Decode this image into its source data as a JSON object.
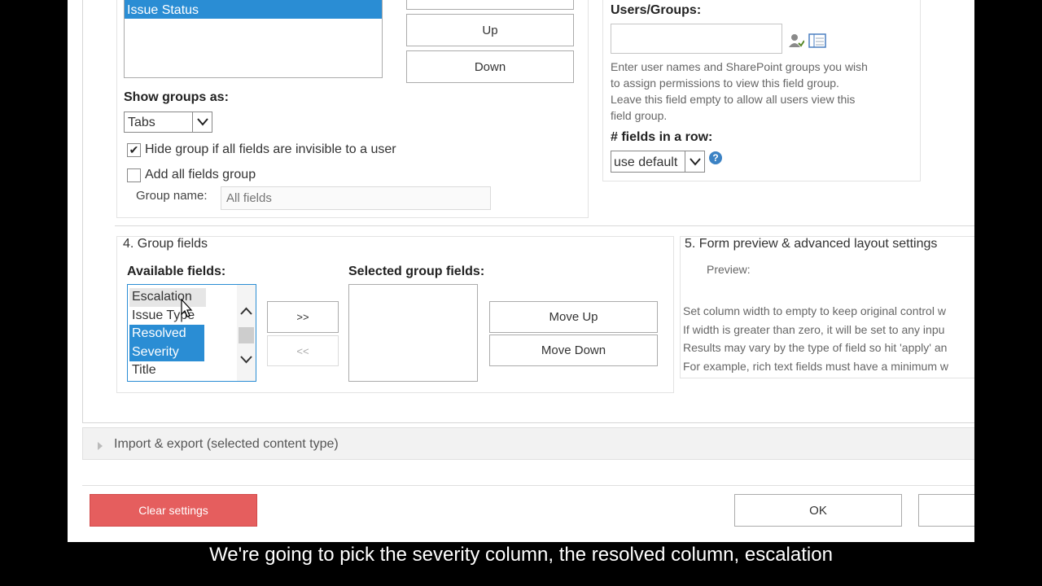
{
  "field_groups": {
    "items": [
      "Issue Status"
    ]
  },
  "order_buttons": {
    "up": "Up",
    "down": "Down"
  },
  "show_groups": {
    "label": "Show groups as:",
    "selected": "Tabs"
  },
  "hide_group": {
    "label": "Hide group if all fields are invisible to a user",
    "checked": true
  },
  "add_all_group": {
    "label": "Add all fields group",
    "checked": false
  },
  "group_name": {
    "label": "Group name:",
    "placeholder": "All fields"
  },
  "users_groups": {
    "label": "Users/Groups:",
    "help": [
      "Enter user names and SharePoint groups you wish",
      "to assign permissions to view this field group.",
      "Leave this field empty to allow all users view this",
      "field group."
    ]
  },
  "fields_in_row": {
    "label": "# fields in a row:",
    "selected": "use default"
  },
  "section4": {
    "title": "4. Group fields",
    "available_label": "Available fields:",
    "available_items": [
      "Escalation",
      "Issue Type",
      "Resolved",
      "Severity",
      "Title"
    ],
    "add_button": ">>",
    "remove_button": "<<",
    "selected_label": "Selected group fields:",
    "move_up": "Move Up",
    "move_down": "Move Down"
  },
  "section5": {
    "title": "5. Form preview & advanced layout settings",
    "preview_label": "Preview:",
    "lines": [
      "Set column width to empty to keep original control w",
      "If width is greater than zero, it will be set to any inpu",
      "Results may vary by the type of field so hit 'apply' an",
      "For example, rich text fields must have a minimum w"
    ]
  },
  "import_export": {
    "label": "Import & export (selected content type)"
  },
  "footer": {
    "clear": "Clear settings",
    "ok": "OK"
  },
  "subtitle": "We're going to pick the severity column, the resolved column, escalation",
  "colors": {
    "selection": "#2a8dd4",
    "clear_button": "#e55e5e",
    "help_icon": "#3b82c4"
  }
}
